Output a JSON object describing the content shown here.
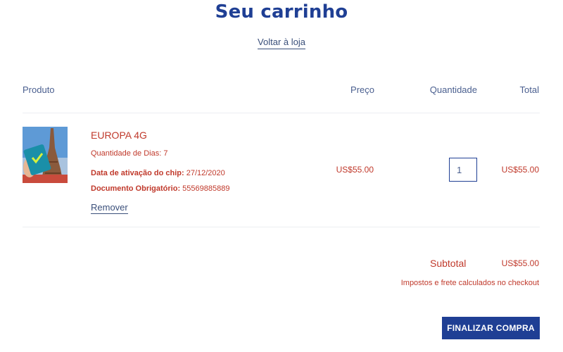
{
  "header": {
    "title": "Seu carrinho",
    "back_link": "Voltar à loja"
  },
  "table": {
    "columns": {
      "product": "Produto",
      "price": "Preço",
      "quantity": "Quantidade",
      "total": "Total"
    }
  },
  "item": {
    "name": "EUROPA 4G",
    "days": "Quantidade de Dias: 7",
    "activation_label": "Data de ativação do chip:",
    "activation_value": "27/12/2020",
    "document_label": "Documento Obrigatório:",
    "document_value": "55569885889",
    "remove_label": "Remover",
    "price": "US$55.00",
    "quantity": "1",
    "line_total": "US$55.00",
    "image_icon": "eiffel-tower-sim-card-image"
  },
  "summary": {
    "subtotal_label": "Subtotal",
    "subtotal_value": "US$55.00",
    "tax_note": "Impostos e frete calculados no checkout",
    "checkout_label": "FINALIZAR COMPRA"
  },
  "colors": {
    "brand_blue": "#1f3f94",
    "price_red": "#c0392b",
    "text_blue": "#4a5f8f"
  }
}
